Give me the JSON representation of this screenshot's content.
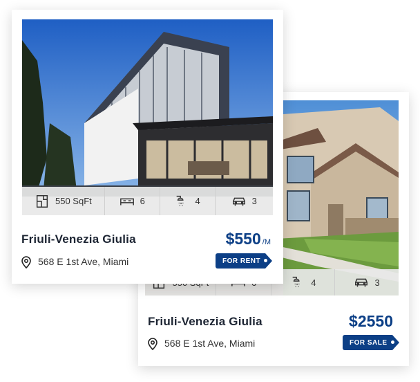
{
  "listings": [
    {
      "title": "Friuli-Venezia Giulia",
      "address": "568 E 1st Ave, Miami",
      "price": "$550",
      "price_unit": "/M",
      "tag": "FOR RENT",
      "stats": {
        "area": "550 SqFt",
        "beds": "6",
        "baths": "4",
        "garage": "3"
      }
    },
    {
      "title": "Friuli-Venezia Giulia",
      "address": "568 E 1st Ave, Miami",
      "price": "$2550",
      "tag": "FOR SALE",
      "stats": {
        "area": "550 SqFt",
        "beds": "6",
        "baths": "4",
        "garage": "3"
      }
    }
  ],
  "colors": {
    "accent": "#0c3f86",
    "title": "#1d2533"
  }
}
